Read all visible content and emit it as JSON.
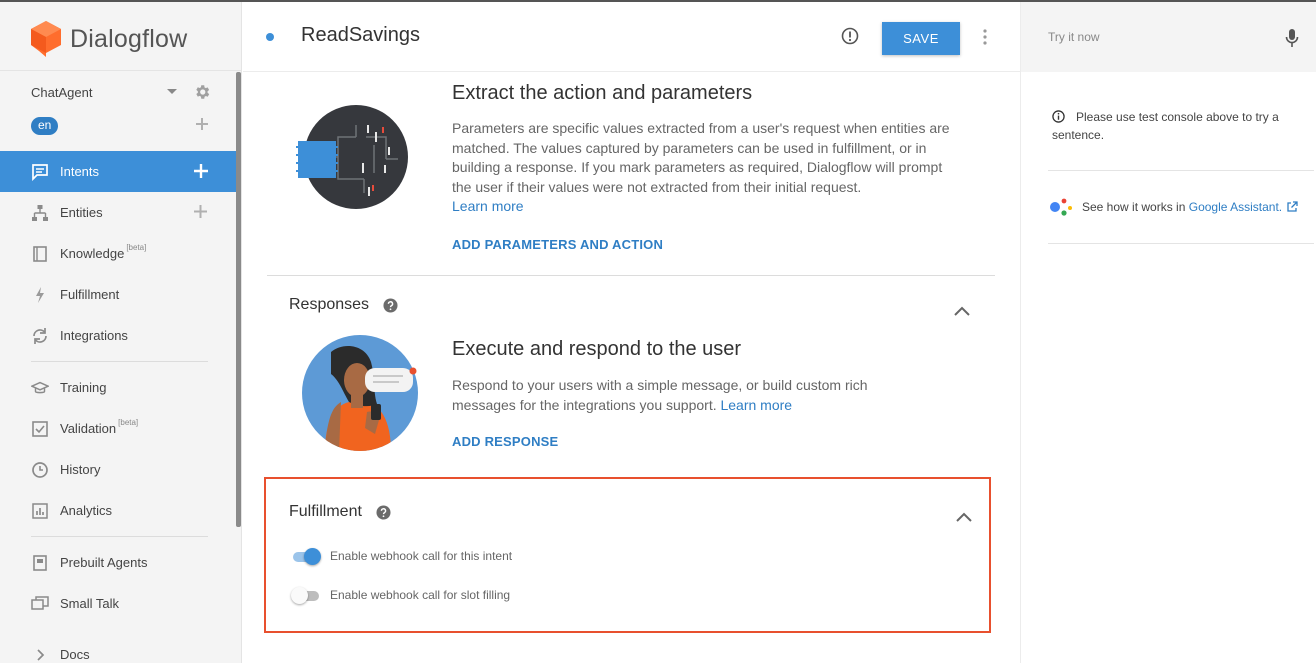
{
  "app": {
    "name": "Dialogflow"
  },
  "agent": {
    "name": "ChatAgent",
    "language": "en"
  },
  "sidebar": {
    "items": [
      {
        "label": "Intents",
        "icon": "chat-bubble-icon",
        "active": true,
        "has_add": true
      },
      {
        "label": "Entities",
        "icon": "hierarchy-icon",
        "has_add": true
      },
      {
        "label": "Knowledge",
        "icon": "book-icon",
        "badge": "[beta]"
      },
      {
        "label": "Fulfillment",
        "icon": "lightning-icon"
      },
      {
        "label": "Integrations",
        "icon": "sync-icon"
      },
      {
        "label": "Training",
        "icon": "graduation-cap-icon"
      },
      {
        "label": "Validation",
        "icon": "checkbox-icon",
        "badge": "[beta]"
      },
      {
        "label": "History",
        "icon": "clock-icon"
      },
      {
        "label": "Analytics",
        "icon": "bar-chart-icon"
      },
      {
        "label": "Prebuilt Agents",
        "icon": "agent-book-icon"
      },
      {
        "label": "Small Talk",
        "icon": "speech-bubbles-icon"
      },
      {
        "label": "Docs",
        "icon": "chevron-right-icon"
      }
    ]
  },
  "header": {
    "title": "ReadSavings",
    "save_label": "SAVE"
  },
  "action_section": {
    "title": "Extract the action and parameters",
    "description": "Parameters are specific values extracted from a user's request when entities are matched. The values captured by parameters can be used in fulfillment, or in building a response. If you mark parameters as required, Dialogflow will prompt the user if their values were not extracted from their initial request.",
    "learn_more": "Learn more",
    "action_link": "ADD PARAMETERS AND ACTION"
  },
  "responses_section": {
    "heading": "Responses",
    "title": "Execute and respond to the user",
    "description": "Respond to your users with a simple message, or build custom rich messages for the integrations you support.",
    "learn_more": "Learn more",
    "action_link": "ADD RESPONSE"
  },
  "fulfillment_section": {
    "heading": "Fulfillment",
    "toggles": [
      {
        "label": "Enable webhook call for this intent",
        "on": true
      },
      {
        "label": "Enable webhook call for slot filling",
        "on": false
      }
    ],
    "highlight_color": "#e8502e"
  },
  "right_panel": {
    "try_placeholder": "Try it now",
    "hint": "Please use test console above to try a sentence.",
    "assistant_prefix": "See how it works in",
    "assistant_link": "Google Assistant."
  },
  "colors": {
    "accent": "#3d8fd8",
    "brand": "#ff6d2d",
    "highlight": "#e8502e"
  }
}
